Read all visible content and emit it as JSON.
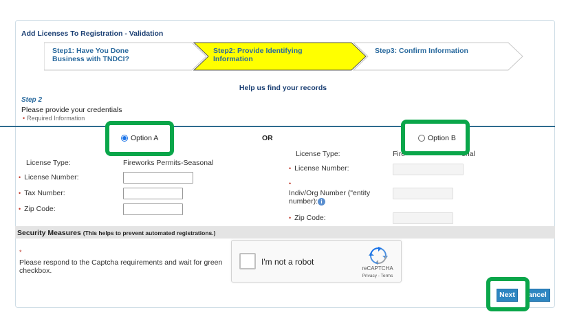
{
  "page": {
    "title": "Add Licenses To Registration - Validation"
  },
  "steps": [
    {
      "line1": "Step1: Have You Done",
      "line2": "Business with TNDCI?",
      "active": false
    },
    {
      "line1": "Step2: Provide Identifying",
      "line2": "Information",
      "active": true
    },
    {
      "line1": "Step3: Confirm Information",
      "line2": "",
      "active": false
    }
  ],
  "colors": {
    "active_step": "#ffff00",
    "highlight": "#0aa64a",
    "divider": "#2e6b8f",
    "button": "#2e86c1"
  },
  "header": {
    "help_title": "Help us find your records",
    "step_label": "Step 2",
    "instructions": "Please provide your credentials",
    "required_note": "Required Information",
    "required_mark": "•"
  },
  "or_label": "OR",
  "option_a": {
    "label": "Option A",
    "selected": true,
    "license_type_label": "License Type:",
    "license_type_value": "Fireworks Permits-Seasonal",
    "license_number_label": "License Number:",
    "tax_number_label": "Tax Number:",
    "zip_label": "Zip Code:"
  },
  "option_b": {
    "label": "Option B",
    "selected": false,
    "license_type_label": "License Type:",
    "license_type_value_left": "Fire",
    "license_type_value_right": "onal",
    "license_number_label": "License Number:",
    "entity_label_line1": "Indiv/Org Number (\"entity",
    "entity_label_line2": "number):",
    "info_icon": "i",
    "zip_label": "Zip Code:"
  },
  "security": {
    "title": "Security Measures",
    "subtitle": "(This helps to prevent automated registrations.)",
    "required_mark": "*",
    "instructions": "Please respond to the Captcha requirements and wait for green checkbox."
  },
  "captcha": {
    "checkbox_label": "I'm not a robot",
    "brand": "reCAPTCHA",
    "privacy": "Privacy",
    "separator": " - ",
    "terms": "Terms"
  },
  "buttons": {
    "next": "Next",
    "cancel": "Cancel",
    "cancel_visible": "ancel"
  }
}
